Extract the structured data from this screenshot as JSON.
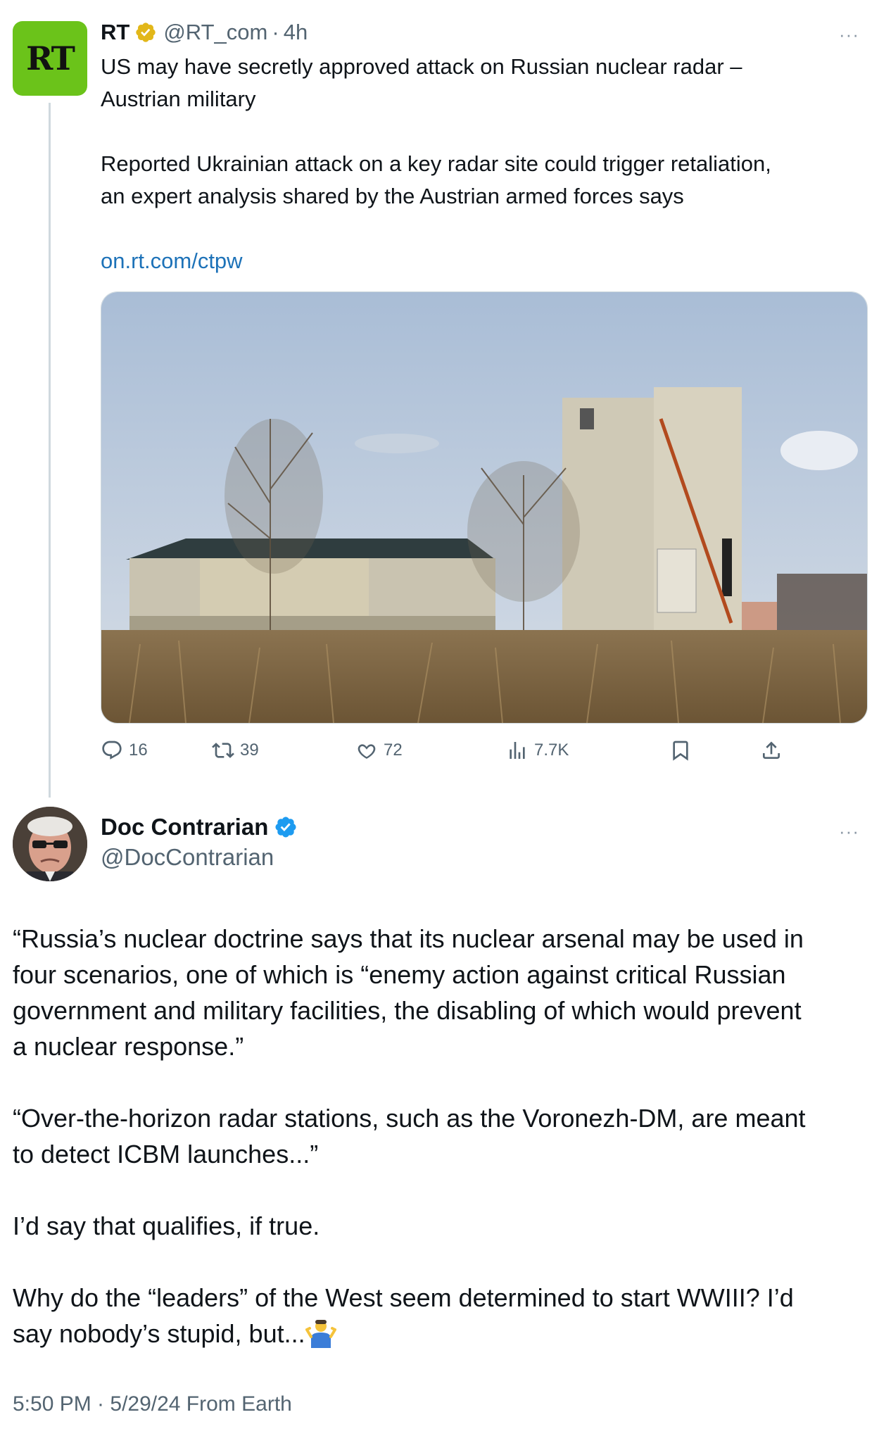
{
  "quoted": {
    "logo_text": "RT",
    "name": "RT",
    "handle": "@RT_com",
    "sep": "·",
    "time": "4h",
    "more": "···",
    "headline_1": "US may have secretly approved attack on Russian nuclear radar –",
    "headline_2": "Austrian military",
    "body_1": "Reported Ukrainian attack on a key radar site could trigger retaliation,",
    "body_2": "an expert analysis shared by the Austrian armed forces says",
    "link": "on.rt.com/ctpw",
    "actions": {
      "replies": "16",
      "retweets": "39",
      "likes": "72",
      "views": "7.7K"
    }
  },
  "tweet": {
    "name": "Doc Contrarian",
    "handle": "@DocContrarian",
    "more": "···",
    "p1_l1": "“Russia’s nuclear doctrine says that its nuclear arsenal may be used in",
    "p1_l2": "four scenarios, one of which is “enemy action against critical Russian",
    "p1_l3": "government and military facilities, the disabling of which would prevent",
    "p1_l4": "a nuclear response.”",
    "p2_l1": "“Over-the-horizon radar stations, such as the Voronezh-DM, are meant",
    "p2_l2": "to detect ICBM launches...”",
    "p3_l1": "I’d say that qualifies, if true.",
    "p4_l1": "Why do the “leaders” of the West seem determined to start WWIII? I’d",
    "p4_l2": "say nobody’s stupid, but...",
    "meta": "5:50 PM · 5/29/24 From Earth"
  },
  "colors": {
    "rt_green": "#6bc31a",
    "verified_gold": "#e2b719",
    "verified_blue": "#1d9bf0",
    "link": "#1d72b8",
    "secondary_text": "#536471"
  },
  "icons": [
    "verified-gold-icon",
    "verified-blue-icon",
    "reply-icon",
    "retweet-icon",
    "like-icon",
    "views-icon",
    "bookmark-icon",
    "share-icon",
    "shrug-emoji"
  ]
}
